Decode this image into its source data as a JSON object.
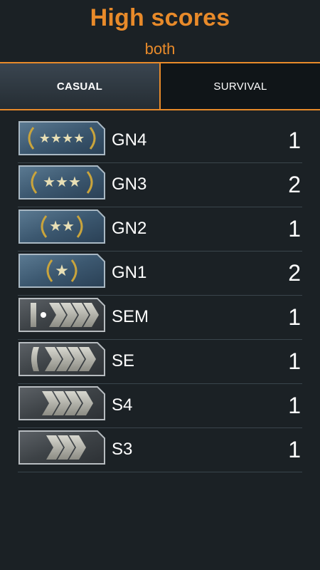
{
  "header": {
    "title": "High scores",
    "subtitle": "both"
  },
  "tabs": [
    {
      "label": "CASUAL",
      "active": true
    },
    {
      "label": "SURVIVAL",
      "active": false
    }
  ],
  "colors": {
    "accent": "#e88a2a",
    "background": "#1b2125",
    "divider": "#3a454c"
  },
  "ranks": [
    {
      "name": "GN4",
      "score": "1",
      "badge": "gold-nova-4-icon"
    },
    {
      "name": "GN3",
      "score": "2",
      "badge": "gold-nova-3-icon"
    },
    {
      "name": "GN2",
      "score": "1",
      "badge": "gold-nova-2-icon"
    },
    {
      "name": "GN1",
      "score": "2",
      "badge": "gold-nova-1-icon"
    },
    {
      "name": "SEM",
      "score": "1",
      "badge": "silver-elite-master-icon"
    },
    {
      "name": "SE",
      "score": "1",
      "badge": "silver-elite-icon"
    },
    {
      "name": "S4",
      "score": "1",
      "badge": "silver-4-icon"
    },
    {
      "name": "S3",
      "score": "1",
      "badge": "silver-3-icon"
    }
  ]
}
